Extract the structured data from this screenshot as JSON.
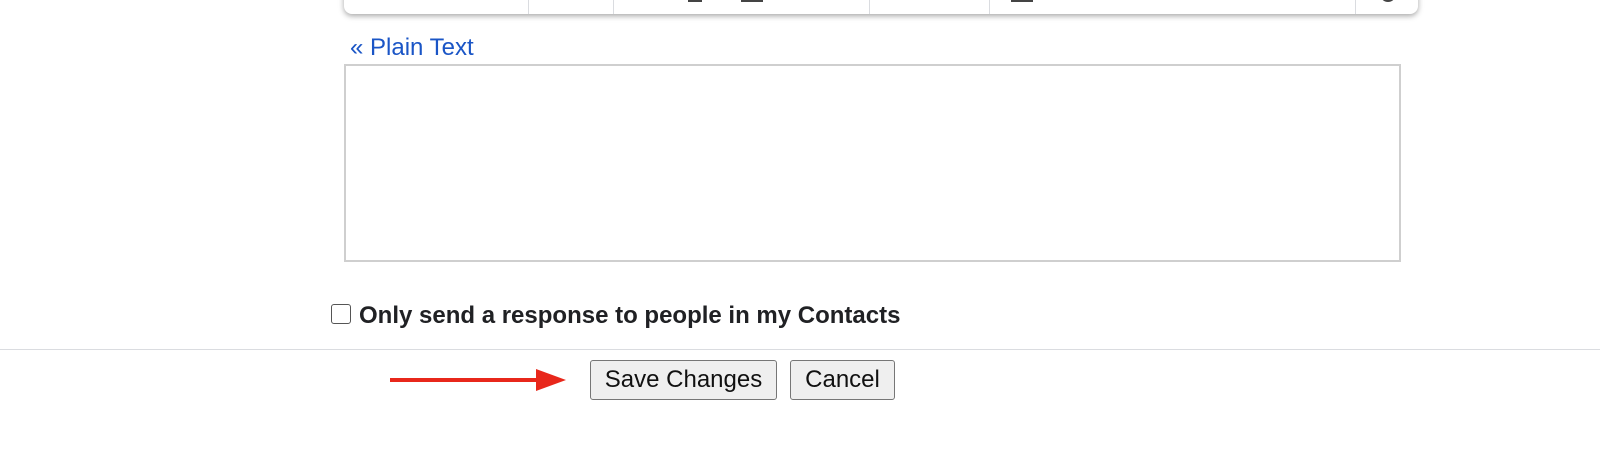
{
  "editor": {
    "toolbar_icons": [
      "undo-icon",
      "redo-icon",
      "format-icon",
      "font-color-icon",
      "underline-icon",
      "text-color-icon",
      "align-icon",
      "numbered-list-icon",
      "bulleted-list-icon",
      "indent-less-icon",
      "indent-more-icon",
      "search-icon"
    ],
    "plain_text_link": "« Plain Text",
    "message_value": ""
  },
  "options": {
    "contacts_only_label": "Only send a response to people in my Contacts",
    "contacts_only_checked": false
  },
  "actions": {
    "save_label": "Save Changes",
    "cancel_label": "Cancel"
  },
  "annotation": {
    "arrow_color": "#e8271b",
    "arrow_target": "save-button"
  },
  "colors": {
    "link": "#1a55c6",
    "button_bg": "#efefef",
    "divider": "#dadce0"
  }
}
